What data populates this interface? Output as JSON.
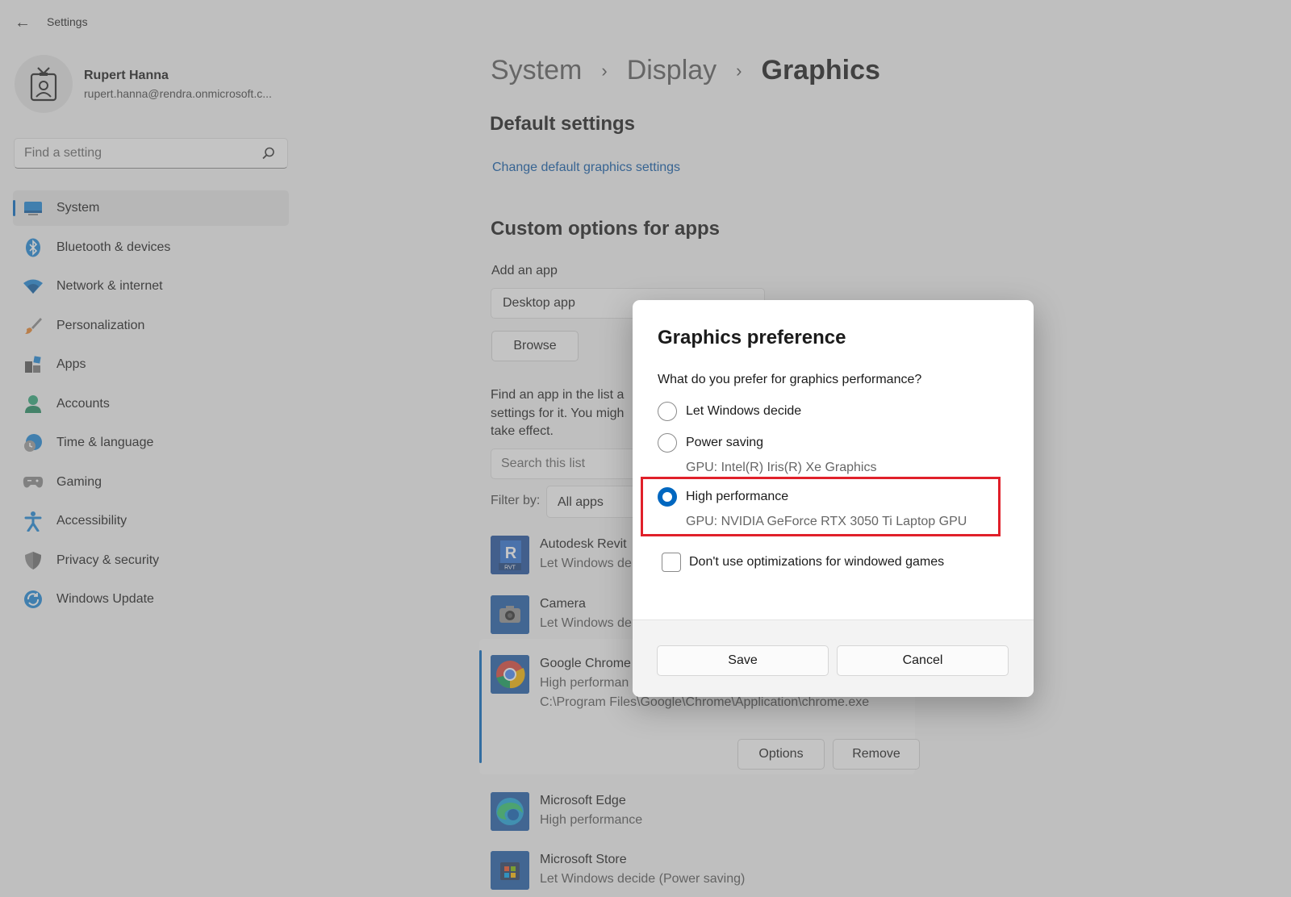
{
  "window": {
    "title": "Settings",
    "back_icon": "arrow-left-icon"
  },
  "profile": {
    "name": "Rupert Hanna",
    "email": "rupert.hanna@rendra.onmicrosoft.c..."
  },
  "search": {
    "placeholder": "Find a setting"
  },
  "nav": {
    "items": [
      {
        "label": "System",
        "icon": "system-icon",
        "active": true
      },
      {
        "label": "Bluetooth & devices",
        "icon": "bluetooth-icon"
      },
      {
        "label": "Network & internet",
        "icon": "wifi-icon"
      },
      {
        "label": "Personalization",
        "icon": "brush-icon"
      },
      {
        "label": "Apps",
        "icon": "apps-icon"
      },
      {
        "label": "Accounts",
        "icon": "person-icon"
      },
      {
        "label": "Time & language",
        "icon": "globe-clock-icon"
      },
      {
        "label": "Gaming",
        "icon": "controller-icon"
      },
      {
        "label": "Accessibility",
        "icon": "accessibility-icon"
      },
      {
        "label": "Privacy & security",
        "icon": "shield-icon"
      },
      {
        "label": "Windows Update",
        "icon": "update-icon"
      }
    ]
  },
  "breadcrumb": {
    "items": [
      "System",
      "Display",
      "Graphics"
    ],
    "separator": "›"
  },
  "main": {
    "default_heading": "Default settings",
    "default_link": "Change default graphics settings",
    "custom_heading": "Custom options for apps",
    "add_app_label": "Add an app",
    "add_app_value": "Desktop app",
    "browse_label": "Browse",
    "find_para": "Find an app in the list a settings for it. You migh take effect.",
    "list_search_placeholder": "Search this list",
    "filter_label": "Filter by:",
    "filter_value": "All apps",
    "apps": [
      {
        "name": "Autodesk Revit",
        "status": "Let Windows de"
      },
      {
        "name": "Camera",
        "status": "Let Windows de"
      },
      {
        "name": "Google Chrome",
        "status": "High performan",
        "path": "C:\\Program Files\\Google\\Chrome\\Application\\chrome.exe"
      },
      {
        "name": "Microsoft Edge",
        "status": "High performance"
      },
      {
        "name": "Microsoft Store",
        "status": "Let Windows decide (Power saving)"
      }
    ],
    "options_label": "Options",
    "remove_label": "Remove"
  },
  "dialog": {
    "title": "Graphics preference",
    "question": "What do you prefer for graphics performance?",
    "options": [
      {
        "label": "Let Windows decide",
        "selected": false
      },
      {
        "label": "Power saving",
        "gpu": "GPU: Intel(R) Iris(R) Xe Graphics",
        "selected": false
      },
      {
        "label": "High performance",
        "gpu": "GPU: NVIDIA GeForce RTX 3050 Ti Laptop GPU",
        "selected": true
      }
    ],
    "checkbox_label": "Don't use optimizations for windowed games",
    "checkbox_checked": false,
    "save_label": "Save",
    "cancel_label": "Cancel",
    "highlight_color": "#e0202a"
  },
  "colors": {
    "accent": "#0067c0",
    "link": "#0a56a6"
  }
}
